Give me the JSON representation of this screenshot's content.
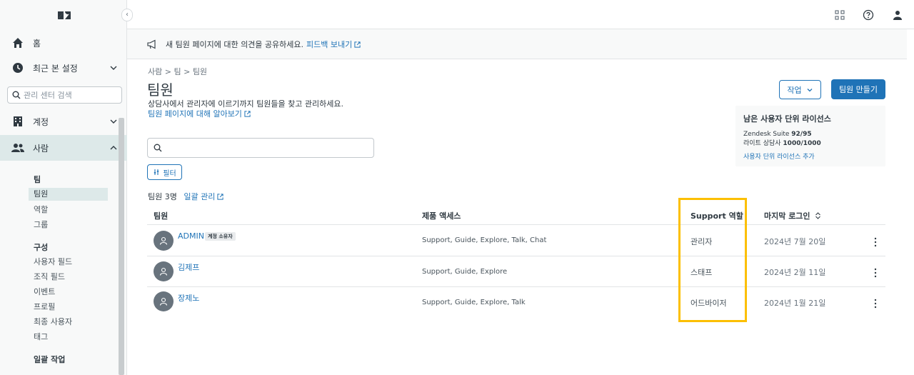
{
  "sidebar": {
    "collapse_label": "‹",
    "nav": [
      {
        "label": "홈",
        "icon": "home-icon"
      },
      {
        "label": "최근 본 설정",
        "icon": "clock-icon"
      },
      {
        "label": "계정",
        "icon": "building-icon"
      },
      {
        "label": "사람",
        "icon": "people-icon"
      }
    ],
    "search_placeholder": "관리 센터 검색",
    "groups": [
      {
        "heading": "팀",
        "items": [
          "팀원",
          "역할",
          "그룹"
        ]
      },
      {
        "heading": "구성",
        "items": [
          "사용자 필드",
          "조직 필드",
          "이벤트",
          "프로필",
          "최종 사용자",
          "태그"
        ]
      },
      {
        "heading": "일괄 작업",
        "items": []
      }
    ]
  },
  "banner": {
    "message": "새 팀원 페이지에 대한 의견을 공유하세요.",
    "link": "피드백 보내기"
  },
  "breadcrumb": [
    "사람",
    "팀",
    "팀원"
  ],
  "page": {
    "title": "팀원",
    "description": "상담사에서 관리자에 이르기까지 팀원들을 찾고 관리하세요.",
    "learn_link": "팀원 페이지에 대해 알아보기"
  },
  "actions": {
    "action_label": "작업",
    "create_label": "팀원 만들기"
  },
  "license": {
    "title": "남은 사용자 단위 라이선스",
    "lines": [
      {
        "label": "Zendesk Suite",
        "value": "92/95"
      },
      {
        "label": "라이트 상담사",
        "value": "1000/1000"
      }
    ],
    "link": "사용자 단위 라이선스 추가"
  },
  "filter_label": "필터",
  "count_text": "팀원 3명",
  "bulk_link": "일괄 관리",
  "table": {
    "headers": [
      "팀원",
      "제품 액세스",
      "Support 역할",
      "마지막 로그인"
    ],
    "rows": [
      {
        "name": "ADMIN",
        "badge": "계정 소유자",
        "access": "Support, Guide, Explore, Talk, Chat",
        "role": "관리자",
        "last_login": "2024년 7월 20일"
      },
      {
        "name": "김제프",
        "badge": "",
        "access": "Support, Guide, Explore",
        "role": "스태프",
        "last_login": "2024년 2월 11일"
      },
      {
        "name": "장제노",
        "badge": "",
        "access": "Support, Guide, Explore, Talk",
        "role": "어드바이저",
        "last_login": "2024년 1월 21일"
      }
    ]
  },
  "colors": {
    "primary": "#1f73b7",
    "highlight": "#fcbf00",
    "active_nav": "#dde9e9"
  }
}
